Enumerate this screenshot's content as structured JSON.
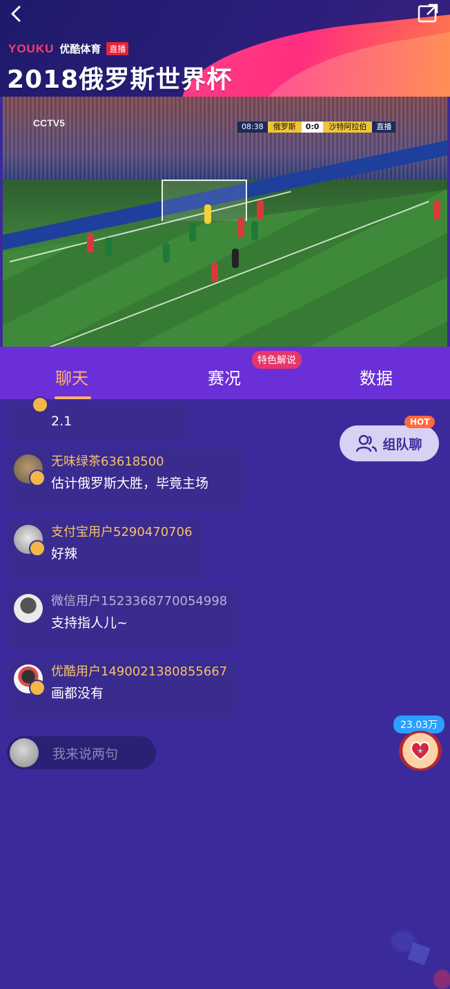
{
  "header": {
    "brand": "YOUKU",
    "brand_sub": "优酷体育",
    "live_tag": "直播",
    "title": "2018俄罗斯世界杯"
  },
  "video": {
    "channel_logo": "CCTV5",
    "scorebug": {
      "time": "08:38",
      "home": "俄罗斯",
      "score": "0:0",
      "away": "沙特阿拉伯",
      "status": "直播"
    }
  },
  "tabs": [
    {
      "label": "聊天"
    },
    {
      "label": "赛况"
    },
    {
      "label": "数据"
    }
  ],
  "tab_badge": "特色解说",
  "messages": [
    {
      "user": "",
      "text": "2.1"
    },
    {
      "user": "无味绿茶63618500",
      "text": "估计俄罗斯大胜，毕竟主场"
    },
    {
      "user": "支付宝用户5290470706",
      "text": "好辣"
    },
    {
      "user": "微信用户1523368770054998",
      "text": "支持指人儿~"
    },
    {
      "user": "优酷用户1490021380855667",
      "text": "画都没有"
    }
  ],
  "team_chat": {
    "label": "组队聊",
    "badge": "HOT"
  },
  "input": {
    "placeholder": "我来说两句"
  },
  "likes": {
    "count": "23.03万"
  },
  "colors": {
    "tab_bar": "#6a2fd6",
    "chat_bg": "#3c2a9c",
    "accent_orange": "#ffb36b",
    "username_gold": "#f6c36a"
  }
}
